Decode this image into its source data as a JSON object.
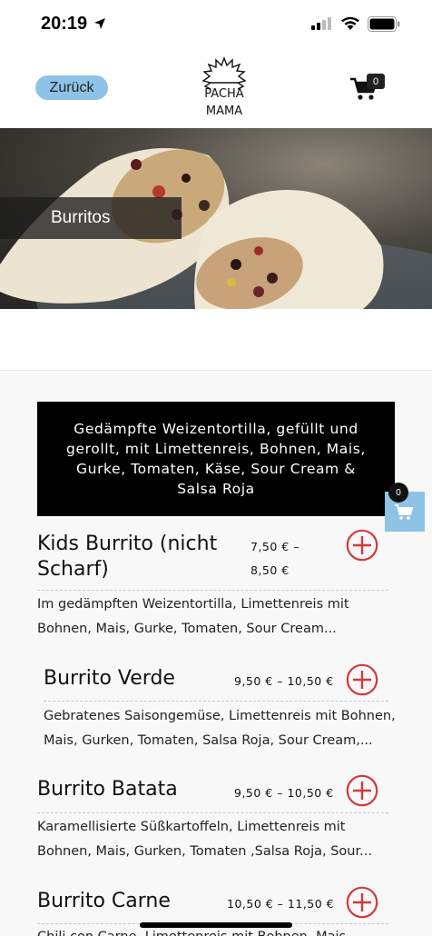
{
  "status": {
    "time": "20:19"
  },
  "header": {
    "back_label": "Zurück",
    "cart_count": "0",
    "logo_text_top": "PACHA",
    "logo_text_bottom": "MAMA"
  },
  "hero": {
    "title": "Burritos"
  },
  "category": {
    "description": "Gedämpfte Weizentortilla, gefüllt und gerollt, mit Limettenreis, Bohnen, Mais, Gurke, Tomaten, Käse, Sour Cream & Salsa Roja"
  },
  "floating_cart": {
    "count": "0"
  },
  "items": [
    {
      "name": "Kids Burrito (nicht Scharf)",
      "price": "7,50 € – 8,50 €",
      "price_line1": "7,50 € –",
      "price_line2": "8,50 €",
      "description": "Im gedämpften Weizentortilla, Limettenreis mit Bohnen, Mais, Gurke, Tomaten, Sour Cream..."
    },
    {
      "name": "Burrito Verde",
      "price": "9,50 € – 10,50 €",
      "description": "Gebratenes Saisongemüse, Limettenreis mit Bohnen, Mais, Gurken, Tomaten, Salsa Roja, Sour Cream,..."
    },
    {
      "name": "Burrito Batata",
      "price": "9,50 € – 10,50 €",
      "description": "Karamellisierte Süßkartoffeln, Limettenreis mit Bohnen, Mais, Gurken, Tomaten ,Salsa Roja, Sour..."
    },
    {
      "name": "Burrito Carne",
      "price": "10,50 € – 11,50 €",
      "description": "Chili con Carne, Limettenreis mit Bohnen, Mais,..."
    }
  ],
  "colors": {
    "accent_blue": "#8ec3e6",
    "add_red": "#d23a3a",
    "banner_bg": "#000000"
  }
}
